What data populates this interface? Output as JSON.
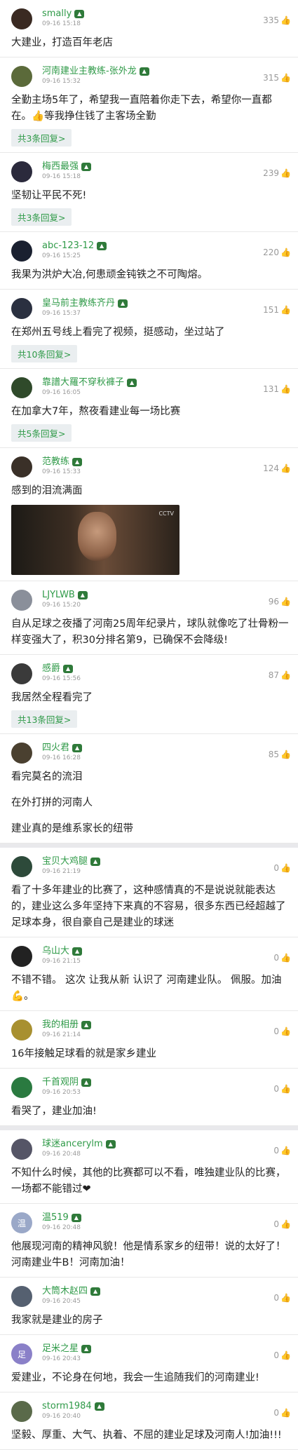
{
  "comments": [
    {
      "name": "smally",
      "time": "09-16 15:18",
      "likes": "335",
      "text": [
        "大建业，打造百年老店"
      ],
      "avatar": "#3a2a22",
      "emoji": "👍"
    },
    {
      "name": "河南建业主教练-张外龙",
      "time": "09-16 15:32",
      "likes": "315",
      "text": [
        "全勤主场5年了，希望我一直陪着你走下去，希望你一直都在。👍等我挣住钱了主客场全勤"
      ],
      "replies": "共3条回复>",
      "avatar": "#5b6a3a"
    },
    {
      "name": "梅西最强",
      "time": "09-16 15:18",
      "likes": "239",
      "text": [
        "坚韧让平民不死!"
      ],
      "replies": "共3条回复>",
      "avatar": "#2b2a3c"
    },
    {
      "name": "abc-123-12",
      "time": "09-16 15:25",
      "likes": "220",
      "text": [
        "我果为洪炉大冶,何患顽金钝铁之不可陶熔。"
      ],
      "avatar": "#1a2030"
    },
    {
      "name": "皇马前主教练齐丹",
      "time": "09-16 15:37",
      "likes": "151",
      "text": [
        "在郑州五号线上看完了视频，挺感动，坐过站了"
      ],
      "replies": "共10条回复>",
      "avatar": "#2a3040"
    },
    {
      "name": "靠譜大羅不穿秋褲子",
      "time": "09-16 16:05",
      "likes": "131",
      "text": [
        "在加拿大7年，熬夜看建业每一场比赛"
      ],
      "replies": "共5条回复>",
      "avatar": "#2f4a2a"
    },
    {
      "name": "范教练",
      "time": "09-16 15:33",
      "likes": "124",
      "text": [
        "感到的泪流满面"
      ],
      "video": true,
      "video_logo": "CCTV",
      "avatar": "#3a3028"
    },
    {
      "name": "LJYLWB",
      "time": "09-16 15:20",
      "likes": "96",
      "text": [
        "自从足球之夜播了河南25周年纪录片，球队就像吃了壮骨粉一样变强大了，积30分排名第9，已确保不会降级!"
      ],
      "avatar": "#8a8f9a"
    },
    {
      "name": "感爵",
      "time": "09-16 15:56",
      "likes": "87",
      "text": [
        "我居然全程看完了"
      ],
      "replies": "共13条回复>",
      "avatar": "#3a3a3a"
    },
    {
      "name": "四火君",
      "time": "09-16 16:28",
      "likes": "85",
      "text": [
        "看完莫名的流泪",
        "在外打拼的河南人",
        "建业真的是维系家长的纽带"
      ],
      "avatar": "#4a4030"
    },
    {
      "name": "宝贝大鸡腿",
      "time": "09-16 21:19",
      "likes": "0",
      "text": [
        "看了十多年建业的比赛了，这种感情真的不是说说就能表达的，建业这么多年坚持下来真的不容易，很多东西已经超越了足球本身，很自豪自己是建业的球迷"
      ],
      "avatar": "#2d4a3a",
      "sep": true
    },
    {
      "name": "乌山大",
      "time": "09-16 21:15",
      "likes": "0",
      "text": [
        "不错不错。 这次 让我从新 认识了 河南建业队。  佩服。加油💪。"
      ],
      "avatar": "#222"
    },
    {
      "name": "我的相册",
      "time": "09-16 21:14",
      "likes": "0",
      "text": [
        "16年接触足球看的就是家乡建业"
      ],
      "avatar": "#a89030"
    },
    {
      "name": "千首观阴",
      "time": "09-16 20:53",
      "likes": "0",
      "text": [
        "看哭了，建业加油!"
      ],
      "avatar": "#2a7a40"
    },
    {
      "name": "球迷ancerylm",
      "time": "09-16 20:48",
      "likes": "0",
      "text": [
        "不知什么时候，其他的比赛都可以不看，唯独建业队的比赛，一场都不能错过❤"
      ],
      "avatar": "#556",
      "sep": true
    },
    {
      "name": "温519",
      "time": "09-16 20:48",
      "likes": "0",
      "text": [
        "他展现河南的精神风貌！他是情系家乡的纽带！说的太好了！河南建业牛B！河南加油！"
      ],
      "avatar": "#9aa8c8",
      "avatar_text": "温"
    },
    {
      "name": "大筒木赵四",
      "time": "09-16 20:45",
      "likes": "0",
      "text": [
        "我家就是建业的房子"
      ],
      "avatar": "#556070"
    },
    {
      "name": "足米之星",
      "time": "09-16 20:43",
      "likes": "0",
      "text": [
        "爱建业，不论身在何地，我会一生追随我们的河南建业!"
      ],
      "avatar": "#8a80c8",
      "avatar_text": "足"
    },
    {
      "name": "storm1984",
      "time": "09-16 20:40",
      "likes": "0",
      "text": [
        "坚毅、厚重、大气、执着、不屈的建业足球及河南人!加油!!!"
      ],
      "avatar": "#5a6a4a"
    }
  ]
}
